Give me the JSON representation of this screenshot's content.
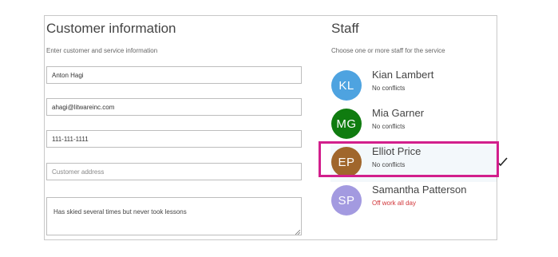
{
  "customer": {
    "title": "Customer information",
    "subtitle": "Enter customer and service information",
    "name_value": "Anton Hagi",
    "email_value": "ahagi@litwareinc.com",
    "phone_value": "111-111-1111",
    "address_placeholder": "Customer address",
    "notes_value": "Has skied several times but never took lessons"
  },
  "staff": {
    "title": "Staff",
    "subtitle": "Choose one or more staff for the service",
    "members": [
      {
        "initials": "KL",
        "name": "Kian Lambert",
        "status": "No conflicts",
        "avatar_color": "#4ea3e0",
        "selected": false
      },
      {
        "initials": "MG",
        "name": "Mia Garner",
        "status": "No conflicts",
        "avatar_color": "#107c10",
        "selected": false
      },
      {
        "initials": "EP",
        "name": "Elliot Price",
        "status": "No conflicts",
        "avatar_color": "#a0662c",
        "selected": true
      },
      {
        "initials": "SP",
        "name": "Samantha Patterson",
        "status": "Off work all day",
        "avatar_color": "#a39ae0",
        "selected": false
      }
    ]
  },
  "colors": {
    "highlight": "#d21f8c",
    "conflict_text": "#d13438"
  }
}
